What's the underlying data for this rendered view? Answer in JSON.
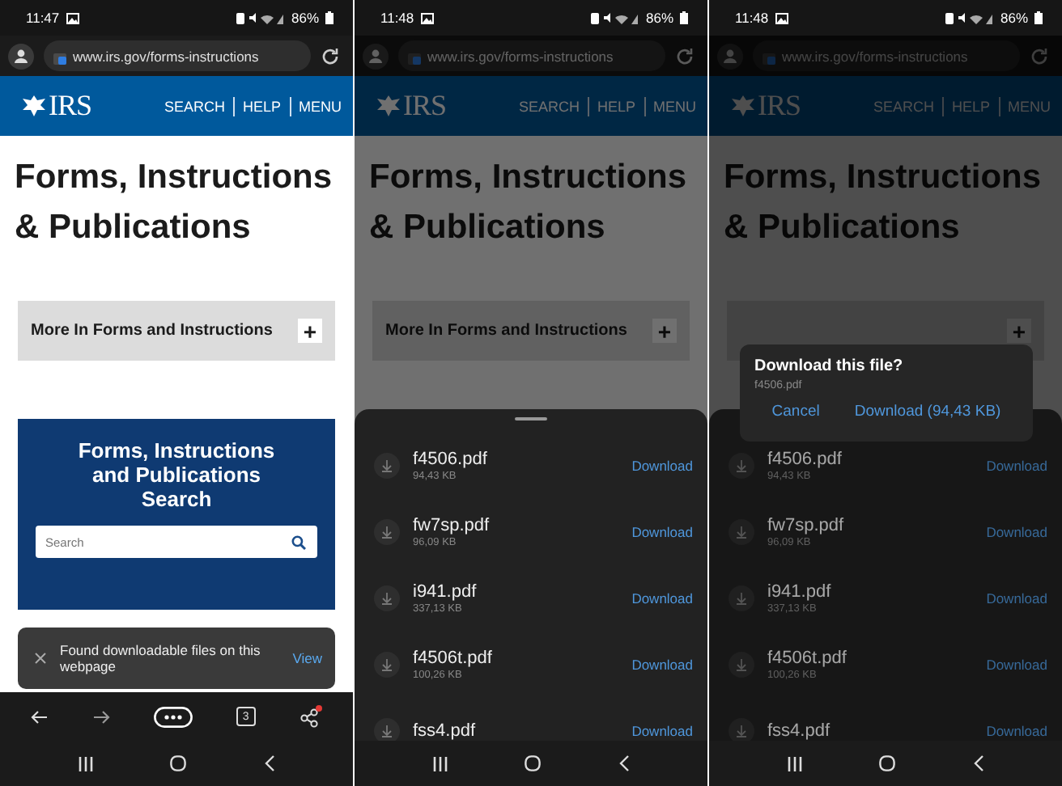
{
  "screens": [
    {
      "status_bar": {
        "time": "11:47",
        "battery": "86%"
      },
      "address_bar": {
        "url": "www.irs.gov/forms-instructions"
      },
      "site_header": {
        "logo": "IRS",
        "nav": [
          "SEARCH",
          "HELP",
          "MENU"
        ]
      },
      "page_title": "Forms, Instructions & Publications",
      "accordion": {
        "label": "More In Forms and Instructions",
        "toggle": "+"
      },
      "search_card": {
        "title": "Forms, Instructions and Publications Search",
        "placeholder": "Search"
      },
      "toast": {
        "message": "Found downloadable files on this webpage",
        "action": "View"
      },
      "toolbar": {
        "tab_count": "3",
        "share_badge": true
      }
    },
    {
      "status_bar": {
        "time": "11:48",
        "battery": "86%"
      },
      "address_bar": {
        "url": "www.irs.gov/forms-instructions"
      },
      "site_header": {
        "logo": "IRS",
        "nav": [
          "SEARCH",
          "HELP",
          "MENU"
        ]
      },
      "page_title": "Forms, Instructions & Publications",
      "accordion": {
        "label": "More In Forms and Instructions",
        "toggle": "+"
      },
      "files_sheet": {
        "files": [
          {
            "name": "f4506.pdf",
            "size": "94,43 KB",
            "action": "Download"
          },
          {
            "name": "fw7sp.pdf",
            "size": "96,09 KB",
            "action": "Download"
          },
          {
            "name": "i941.pdf",
            "size": "337,13 KB",
            "action": "Download"
          },
          {
            "name": "f4506t.pdf",
            "size": "100,26 KB",
            "action": "Download"
          },
          {
            "name": "fss4.pdf",
            "action": "Download"
          }
        ]
      }
    },
    {
      "status_bar": {
        "time": "11:48",
        "battery": "86%"
      },
      "address_bar": {
        "url": "www.irs.gov/forms-instructions"
      },
      "site_header": {
        "logo": "IRS",
        "nav": [
          "SEARCH",
          "HELP",
          "MENU"
        ]
      },
      "page_title": "Forms, Instructions & Publications",
      "accordion": {
        "toggle": "+"
      },
      "files_sheet": {
        "files": [
          {
            "name": "f4506.pdf",
            "size": "94,43 KB",
            "action": "Download"
          },
          {
            "name": "fw7sp.pdf",
            "size": "96,09 KB",
            "action": "Download"
          },
          {
            "name": "i941.pdf",
            "size": "337,13 KB",
            "action": "Download"
          },
          {
            "name": "f4506t.pdf",
            "size": "100,26 KB",
            "action": "Download"
          },
          {
            "name": "fss4.pdf",
            "action": "Download"
          }
        ]
      },
      "dialog": {
        "title": "Download this file?",
        "file": "f4506.pdf",
        "buttons": [
          "Cancel",
          "Download (94,43 KB)"
        ]
      }
    }
  ]
}
